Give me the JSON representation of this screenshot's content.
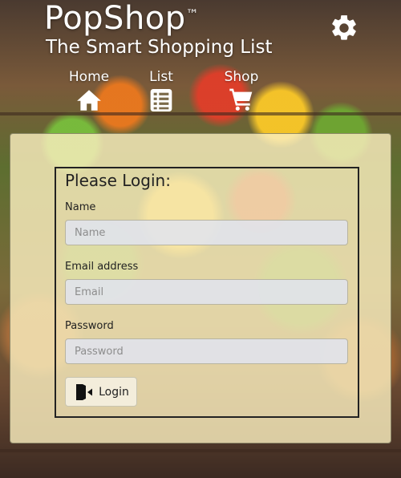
{
  "app": {
    "name": "PopShop",
    "trademark": "™",
    "tagline": "The Smart Shopping List"
  },
  "nav": {
    "items": [
      {
        "label": "Home",
        "icon": "home-icon"
      },
      {
        "label": "List",
        "icon": "list-icon"
      },
      {
        "label": "Shop",
        "icon": "cart-icon"
      }
    ],
    "settings_icon": "gear-icon"
  },
  "login": {
    "title": "Please Login:",
    "fields": [
      {
        "label": "Name",
        "placeholder": "Name",
        "value": ""
      },
      {
        "label": "Email address",
        "placeholder": "Email",
        "value": ""
      },
      {
        "label": "Password",
        "placeholder": "Password",
        "value": ""
      }
    ],
    "button_label": "Login",
    "button_icon": "login-door-icon"
  },
  "colors": {
    "panel": "#faeebe",
    "text": "#222222",
    "input_bg": "#e1e4f0"
  }
}
